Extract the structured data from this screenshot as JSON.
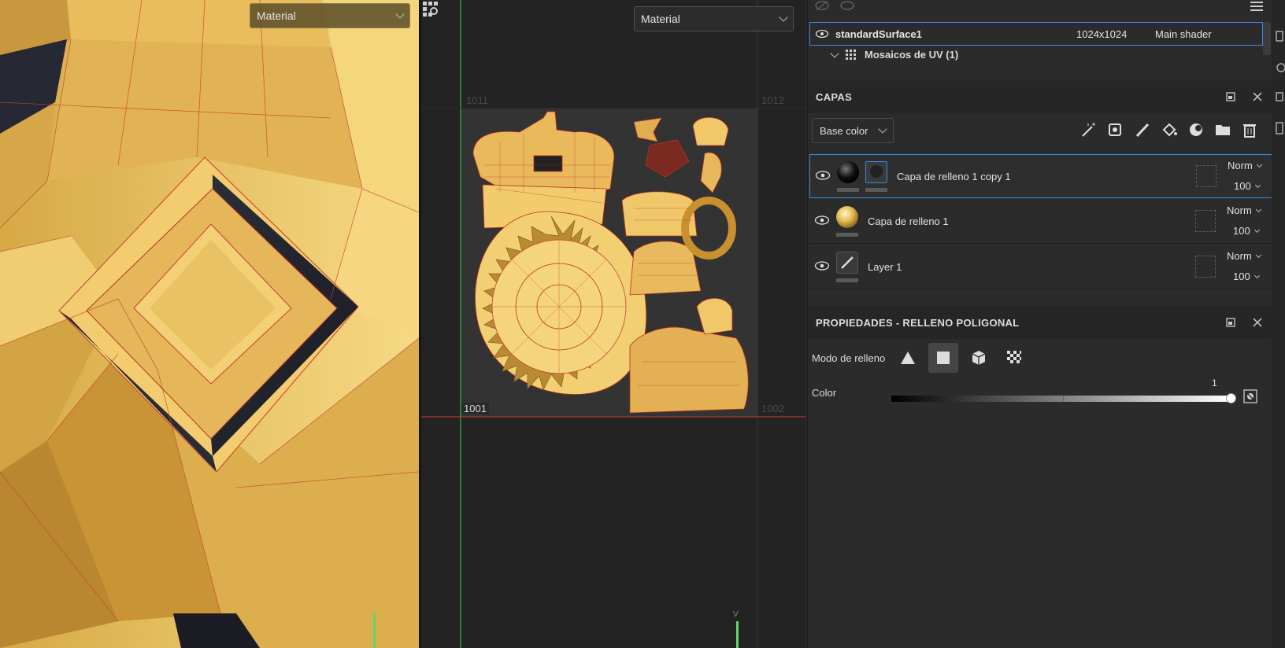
{
  "viewport3d": {
    "material_dropdown": "Material"
  },
  "uv_viewport": {
    "material_dropdown": "Material",
    "tiles": {
      "top_left": "1011",
      "top_right": "1012",
      "bottom_left": "1001",
      "bottom_right": "1002"
    },
    "axis_label": "V"
  },
  "texture_set": {
    "name": "standardSurface1",
    "resolution": "1024x1024",
    "shader": "Main shader",
    "uv_tiles_label": "Mosaicos de UV (1)"
  },
  "layers_panel": {
    "title": "CAPAS",
    "channel": "Base color",
    "layers": [
      {
        "name": "Capa de relleno 1 copy 1",
        "blend": "Norm",
        "opacity": "100",
        "thumb": "black-sphere"
      },
      {
        "name": "Capa de relleno 1",
        "blend": "Norm",
        "opacity": "100",
        "thumb": "gold-sphere"
      },
      {
        "name": "Layer 1",
        "blend": "Norm",
        "opacity": "100",
        "thumb": "brush"
      }
    ]
  },
  "properties_panel": {
    "title": "PROPIEDADES - RELLENO POLIGONAL",
    "fill_mode_label": "Modo de relleno",
    "color_label": "Color",
    "color_value": "1",
    "color_value_fraction": 1.0
  },
  "colors": {
    "accent": "#3a8be0",
    "model": "#e8c066",
    "wire": "#d23a2a"
  }
}
